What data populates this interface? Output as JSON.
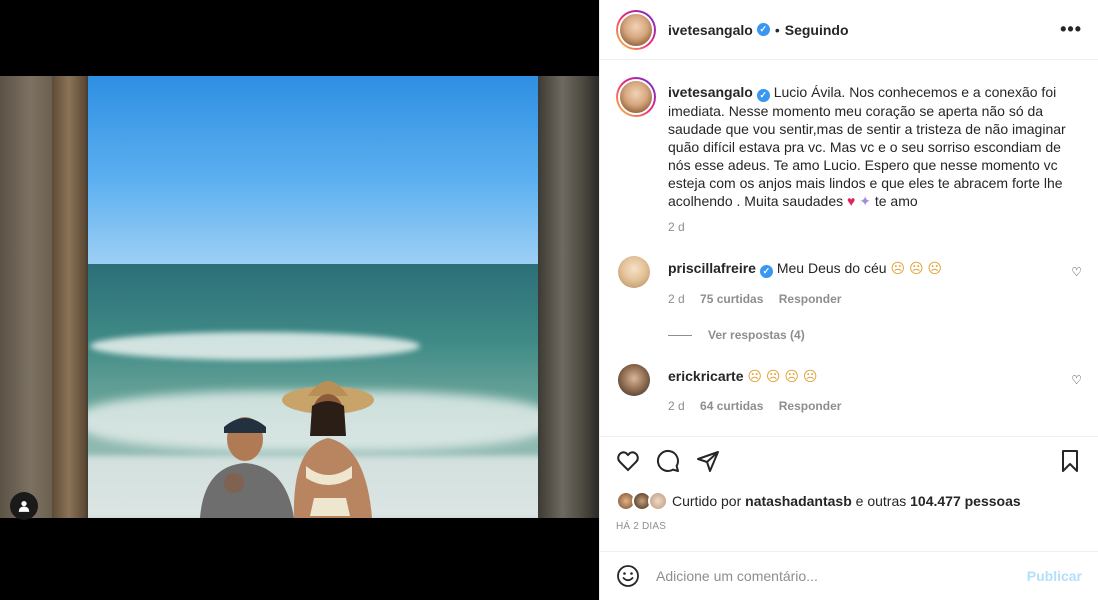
{
  "post": {
    "username": "ivetesangalo",
    "follow_status": "Seguindo",
    "more_label": "•••",
    "caption": "Lucio Ávila. Nos conhecemos e a conexão foi imediata. Nesse momento meu coração se aperta não só da saudade que vou sentir,mas de sentir a tristeza de não imaginar quão difícil estava pra vc. Mas vc e o seu sorriso escondiam de nós esse adeus. Te amo Lucio. Espero que nesse momento vc esteja com os anjos mais lindos e que eles te abracem forte lhe acolhendo . Muita saudades",
    "caption_tail": "te amo",
    "caption_emoji_heart": "♥",
    "caption_emoji_angel": "✦",
    "caption_age": "2 d",
    "comments": [
      {
        "username": "priscillafreire",
        "text": "Meu Deus do céu",
        "emojis": "☹ ☹ ☹",
        "age": "2 d",
        "likes": "75 curtidas",
        "reply": "Responder",
        "replies": "Ver respostas (4)"
      },
      {
        "username": "erickricarte",
        "text": "",
        "emojis": "☹ ☹ ☹ ☹",
        "age": "2 d",
        "likes": "64 curtidas",
        "reply": "Responder"
      }
    ],
    "liked_prefix": "Curtido por",
    "liked_by": "natashadantasb",
    "liked_mid": "e outras",
    "liked_count": "104.477 pessoas",
    "timestamp": "HÁ 2 DIAS",
    "comment_placeholder": "Adicione um comentário...",
    "publish_label": "Publicar"
  },
  "icons": {
    "like": "heart-icon",
    "comment": "comment-icon",
    "share": "share-icon",
    "save": "bookmark-icon",
    "emoji": "smile-icon",
    "user_tag": "user-icon"
  },
  "colors": {
    "verified": "#3897f0",
    "publish_disabled": "#b2dffc",
    "heart": "#e0245e"
  }
}
